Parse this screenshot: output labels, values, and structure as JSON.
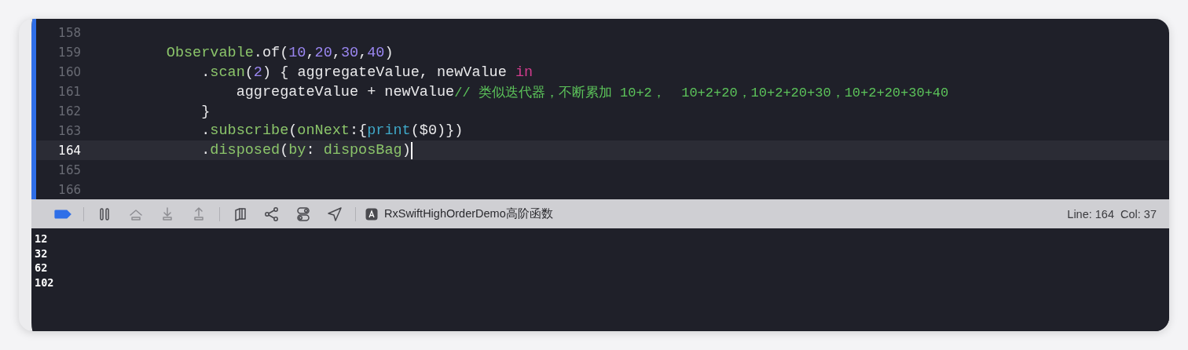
{
  "editor": {
    "lines": [
      {
        "number": "158",
        "current": false
      },
      {
        "number": "159",
        "current": false,
        "tokens": [
          {
            "text": "        Observable",
            "kind": "type"
          },
          {
            "text": ".of(",
            "kind": "plain"
          },
          {
            "text": "10",
            "kind": "number"
          },
          {
            "text": ",",
            "kind": "plain"
          },
          {
            "text": "20",
            "kind": "number"
          },
          {
            "text": ",",
            "kind": "plain"
          },
          {
            "text": "30",
            "kind": "number"
          },
          {
            "text": ",",
            "kind": "plain"
          },
          {
            "text": "40",
            "kind": "number"
          },
          {
            "text": ")",
            "kind": "plain"
          }
        ]
      },
      {
        "number": "160",
        "current": false,
        "tokens": [
          {
            "text": "            .",
            "kind": "plain"
          },
          {
            "text": "scan",
            "kind": "method"
          },
          {
            "text": "(",
            "kind": "plain"
          },
          {
            "text": "2",
            "kind": "number"
          },
          {
            "text": ") { aggregateValue, newValue ",
            "kind": "plain"
          },
          {
            "text": "in",
            "kind": "keyword"
          }
        ]
      },
      {
        "number": "161",
        "current": false,
        "tokens": [
          {
            "text": "                aggregateValue + newValue",
            "kind": "plain"
          },
          {
            "text": "// 类似迭代器，不断累加 10+2，  10+2+20，10+2+20+30，10+2+20+30+40",
            "kind": "comment"
          }
        ]
      },
      {
        "number": "162",
        "current": false,
        "tokens": [
          {
            "text": "            }",
            "kind": "plain"
          }
        ]
      },
      {
        "number": "163",
        "current": false,
        "tokens": [
          {
            "text": "            .",
            "kind": "plain"
          },
          {
            "text": "subscribe",
            "kind": "method"
          },
          {
            "text": "(",
            "kind": "plain"
          },
          {
            "text": "onNext",
            "kind": "method"
          },
          {
            "text": ":{",
            "kind": "plain"
          },
          {
            "text": "print",
            "kind": "builtin"
          },
          {
            "text": "($0)})",
            "kind": "plain"
          }
        ]
      },
      {
        "number": "164",
        "current": true,
        "tokens": [
          {
            "text": "            .",
            "kind": "plain"
          },
          {
            "text": "disposed",
            "kind": "method"
          },
          {
            "text": "(",
            "kind": "plain"
          },
          {
            "text": "by",
            "kind": "method"
          },
          {
            "text": ": ",
            "kind": "plain"
          },
          {
            "text": "disposBag",
            "kind": "method"
          },
          {
            "text": ")",
            "kind": "plain"
          }
        ]
      },
      {
        "number": "165",
        "current": false
      },
      {
        "number": "166",
        "current": false
      }
    ]
  },
  "debug_bar": {
    "buttons": [
      {
        "kind": "breakpoints",
        "on": true,
        "disabled": false
      },
      {
        "kind": "pause",
        "disabled": false
      },
      {
        "kind": "step-over",
        "disabled": true
      },
      {
        "kind": "step-into",
        "disabled": true
      },
      {
        "kind": "step-out",
        "disabled": true
      },
      {
        "kind": "view-hierarchy",
        "disabled": false
      },
      {
        "kind": "memory-graph",
        "disabled": false
      },
      {
        "kind": "environment",
        "disabled": false
      },
      {
        "kind": "location",
        "disabled": false
      }
    ],
    "scheme": "RxSwiftHighOrderDemo高阶函数",
    "position": "Line: 164  Col: 37"
  },
  "console": {
    "output": [
      "12",
      "32",
      "62",
      "102"
    ]
  }
}
